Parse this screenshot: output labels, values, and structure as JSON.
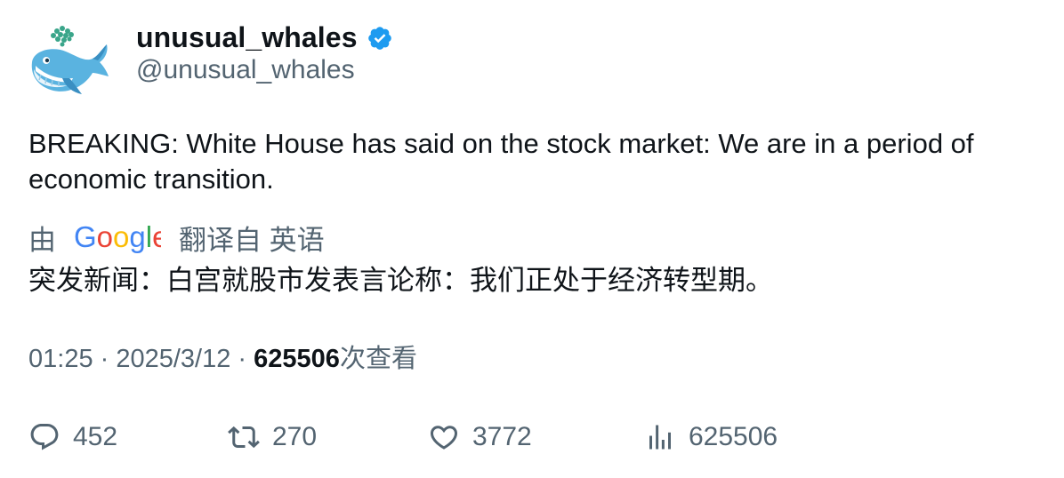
{
  "author": {
    "display_name": "unusual_whales",
    "handle": "@unusual_whales",
    "verified": true,
    "verified_color": "#1d9bf0"
  },
  "tweet": {
    "text": "BREAKING: White House has said on the stock market: We are in a period of economic transition.",
    "translation": {
      "prefix": "由",
      "provider": "Google",
      "suffix": "翻译自 英语",
      "text": "突发新闻：白宫就股市发表言论称：我们正处于经济转型期。"
    },
    "meta": {
      "time": "01:25",
      "separator": " · ",
      "date": "2025/3/12",
      "views_count": "625506",
      "views_label": "次查看"
    }
  },
  "actions": {
    "reply": {
      "icon": "reply-icon",
      "count": "452"
    },
    "retweet": {
      "icon": "retweet-icon",
      "count": "270"
    },
    "like": {
      "icon": "heart-icon",
      "count": "3772"
    },
    "views": {
      "icon": "analytics-icon",
      "count": "625506"
    }
  },
  "colors": {
    "text_primary": "#0f1419",
    "text_secondary": "#536471",
    "google_blue": "#4285f4",
    "google_red": "#ea4335",
    "google_yellow": "#fbbc05",
    "google_green": "#34a853"
  }
}
